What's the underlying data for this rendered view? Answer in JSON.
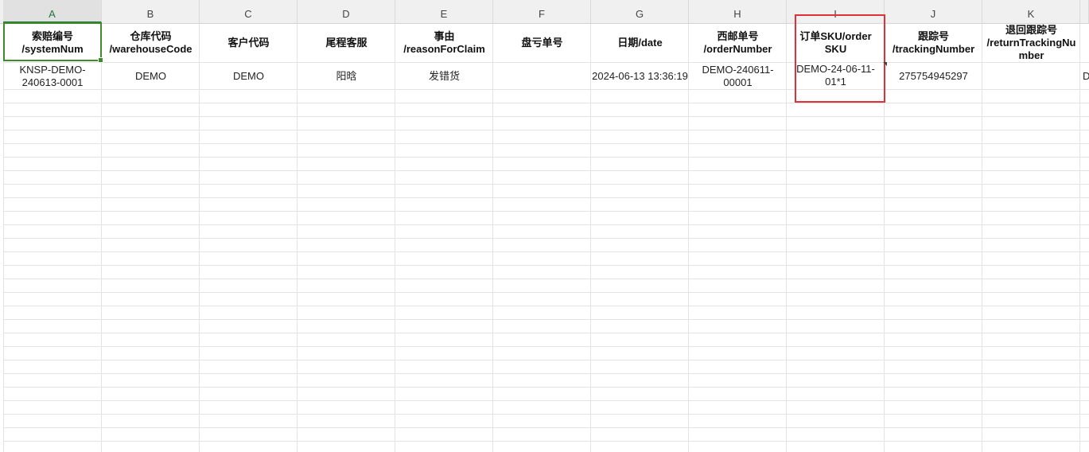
{
  "columns": [
    "A",
    "B",
    "C",
    "D",
    "E",
    "F",
    "G",
    "H",
    "I",
    "J",
    "K",
    ""
  ],
  "headers": {
    "A": "索赔编号\n/systemNum",
    "B": "仓库代码\n/warehouseCode",
    "C": "客户代码",
    "D": "尾程客服",
    "E": "事由\n/reasonForClaim",
    "F": "盘亏单号",
    "G": "日期/date",
    "H": "西邮单号\n/orderNumber",
    "I": "订单SKU/order\nSKU",
    "J": "跟踪号\n/trackingNumber",
    "K": "退回跟踪号\n/returnTrackingNu\nmber"
  },
  "row1": {
    "A": "KNSP-DEMO-\n240613-0001",
    "B": "DEMO",
    "C": "DEMO",
    "D": "阳晗",
    "E": "发错货",
    "F": "",
    "G": "2024-06-13 13:36:19",
    "H": "DEMO-240611-\n00001",
    "I": "DEMO-24-06-11-\n01*1",
    "J": "275754945297",
    "K": "",
    "L": "D"
  },
  "selection": {
    "active_cell": "A1",
    "highlight_color": "#3c8c2a",
    "annotation_color": "#e0303a"
  }
}
